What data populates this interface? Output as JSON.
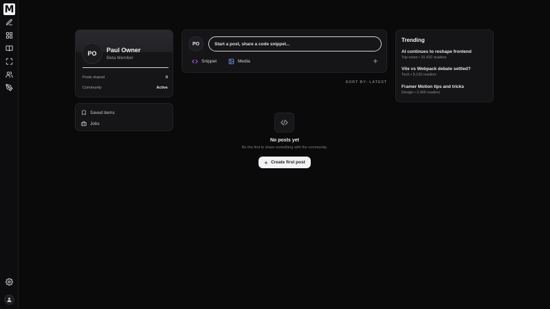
{
  "app": {
    "logo_letter": "M"
  },
  "rail": {
    "items": [
      {
        "icon": "edit-icon"
      },
      {
        "icon": "grid-icon"
      },
      {
        "icon": "book-icon"
      },
      {
        "icon": "scan-icon"
      },
      {
        "icon": "users-icon"
      },
      {
        "icon": "pen-tool-icon"
      }
    ],
    "bottom": {
      "icon": "settings-icon"
    },
    "avatar": {
      "icon": "person-icon"
    }
  },
  "profile": {
    "initials": "PO",
    "name": "Paul Owner",
    "role": "Beta Member",
    "stats": [
      {
        "label": "Posts shared",
        "value": "0"
      },
      {
        "label": "Community",
        "value": "Active"
      }
    ]
  },
  "links": [
    {
      "label": "Saved items",
      "icon": "bookmark-icon"
    },
    {
      "label": "Jobs",
      "icon": "briefcase-icon"
    }
  ],
  "composer": {
    "initials": "PO",
    "placeholder": "Start a post, share a code snippet...",
    "actions": [
      {
        "label": "Snippet",
        "icon": "code-icon",
        "color": "#b06cf7"
      },
      {
        "label": "Media",
        "icon": "image-icon",
        "color": "#5a8cf5"
      }
    ],
    "more_icon": "plus-icon"
  },
  "feed": {
    "sort_label": "SORT BY: LATEST",
    "empty": {
      "icon": "code-icon",
      "title": "No posts yet",
      "subtitle": "Be the first to share something with the community.",
      "cta_label": "Create first post"
    }
  },
  "trending": {
    "heading": "Trending",
    "items": [
      {
        "title": "AI continues to reshape frontend",
        "meta": "Top news • 10,432 readers"
      },
      {
        "title": "Vite vs Webpack debate settled?",
        "meta": "Tech • 5,120 readers"
      },
      {
        "title": "Framer Motion tips and tricks",
        "meta": "Design • 2,400 readers"
      }
    ]
  }
}
